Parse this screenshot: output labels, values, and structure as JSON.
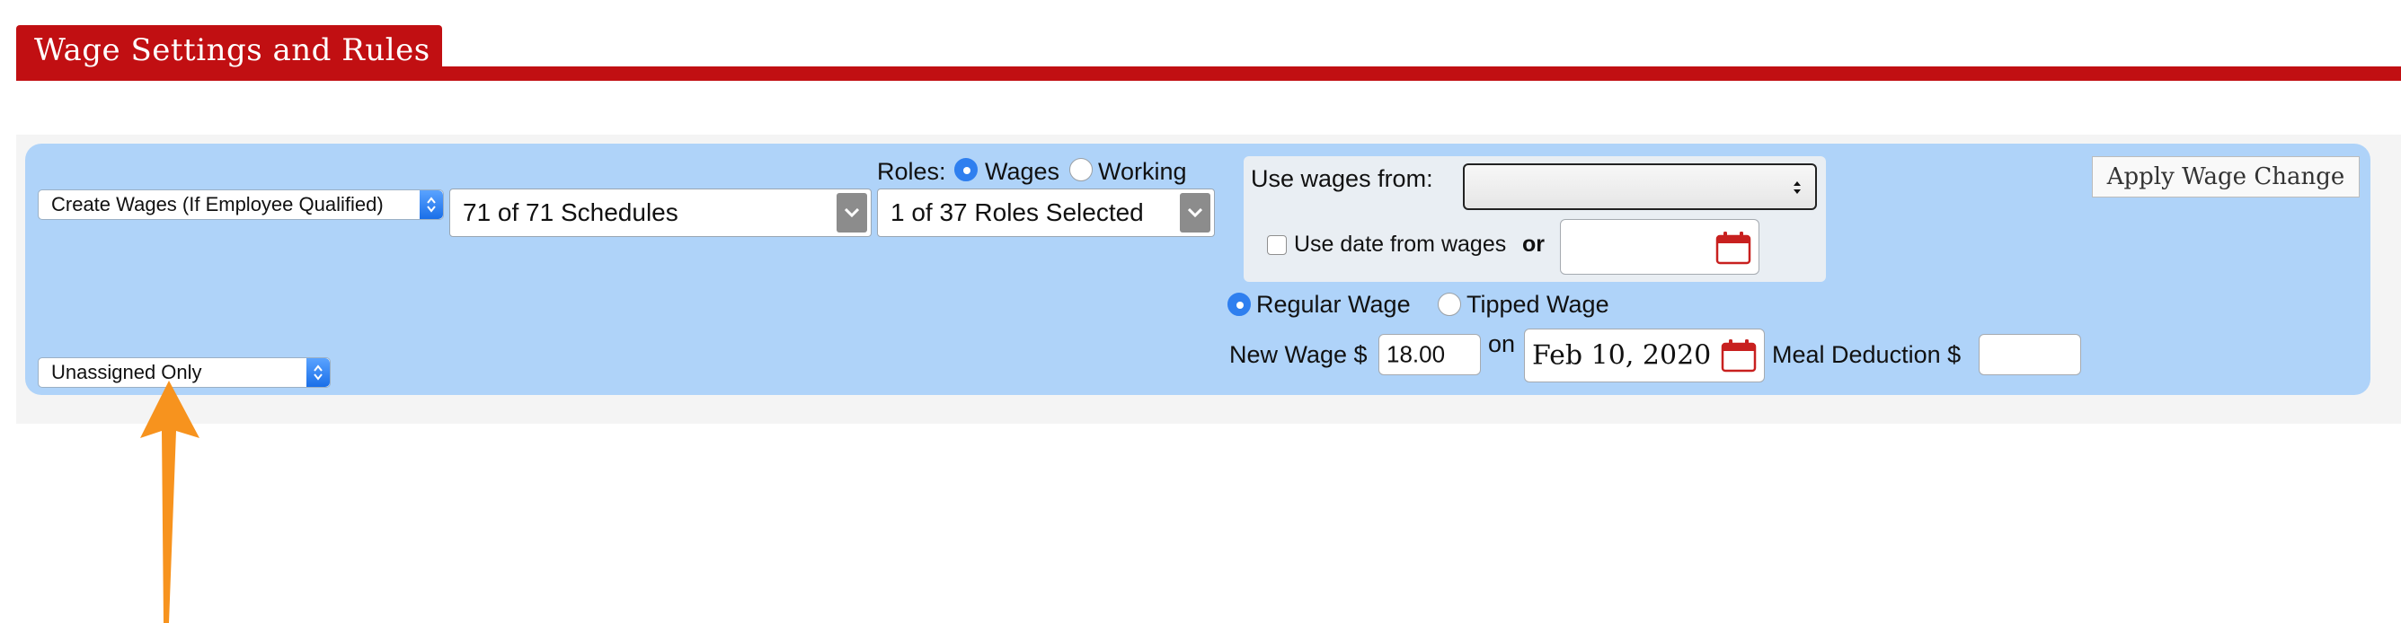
{
  "header": {
    "title": "Wage Settings and Rules"
  },
  "filters": {
    "create_mode": "Create Wages (If Employee Qualified)",
    "schedules": "71 of 71 Schedules",
    "roles_selected": "1 of 37 Roles Selected",
    "assignment": "Unassigned Only"
  },
  "roles": {
    "label": "Roles:",
    "options": [
      {
        "label": "Wages",
        "selected": true
      },
      {
        "label": "Working",
        "selected": false
      }
    ]
  },
  "use_wages": {
    "label": "Use wages from:",
    "selected": "",
    "use_date_label": "Use date from wages",
    "or_label": "or",
    "date_value": ""
  },
  "wage_type": {
    "options": [
      {
        "label": "Regular Wage",
        "selected": true
      },
      {
        "label": "Tipped Wage",
        "selected": false
      }
    ]
  },
  "new_wage": {
    "label": "New Wage $",
    "value": "18.00",
    "on_label": "on",
    "date": "Feb 10, 2020",
    "meal_label": "Meal Deduction $",
    "meal_value": ""
  },
  "actions": {
    "apply_label": "Apply Wage Change"
  },
  "colors": {
    "header": "#c10f12",
    "panel": "#afd3f9",
    "accent": "#2f7fef",
    "arrow": "#f7931e"
  },
  "icons": {
    "calendar": "calendar-icon",
    "arrow": "up-arrow-annotation"
  }
}
